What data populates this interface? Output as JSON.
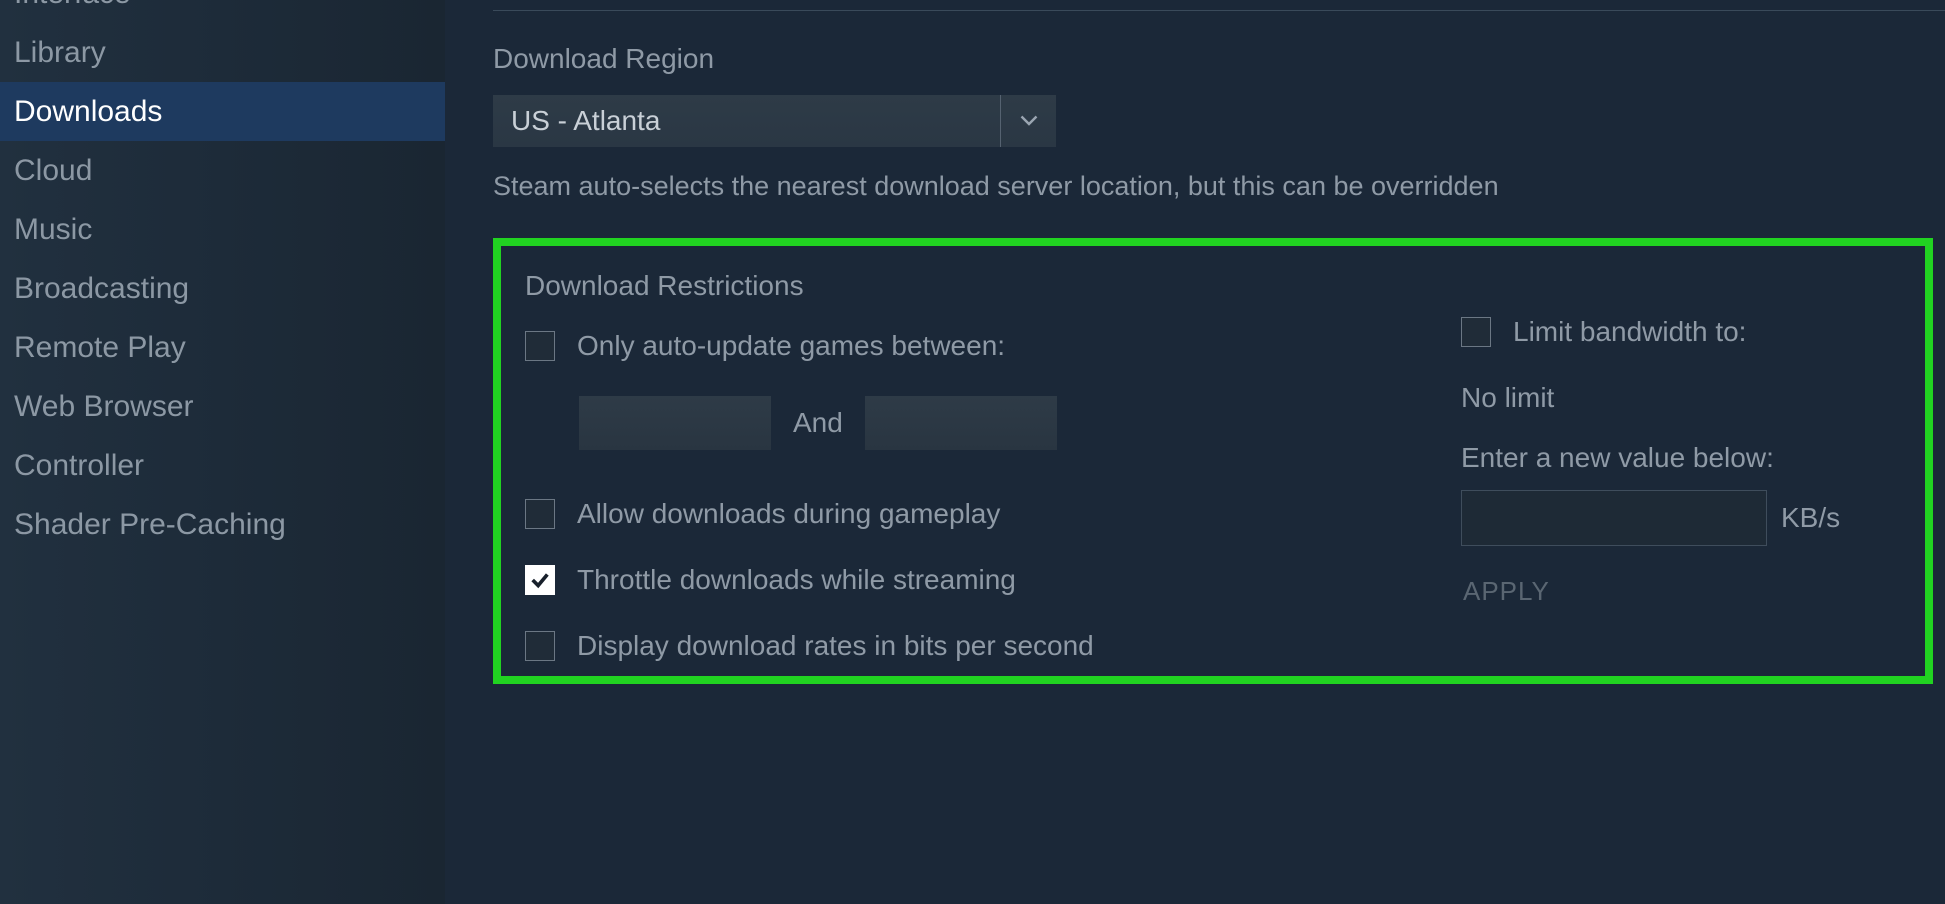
{
  "sidebar": {
    "items": [
      {
        "label": "Interface"
      },
      {
        "label": "Library"
      },
      {
        "label": "Downloads"
      },
      {
        "label": "Cloud"
      },
      {
        "label": "Music"
      },
      {
        "label": "Broadcasting"
      },
      {
        "label": "Remote Play"
      },
      {
        "label": "Web Browser"
      },
      {
        "label": "Controller"
      },
      {
        "label": "Shader Pre-Caching"
      }
    ],
    "selected_index": 2
  },
  "region": {
    "label": "Download Region",
    "value": "US - Atlanta",
    "helper": "Steam auto-selects the nearest download server location, but this can be overridden"
  },
  "restrictions": {
    "title": "Download Restrictions",
    "auto_update": {
      "label": "Only auto-update games between:",
      "checked": false,
      "and_text": "And",
      "from_value": "",
      "to_value": ""
    },
    "allow_during_gameplay": {
      "label": "Allow downloads during gameplay",
      "checked": false
    },
    "throttle_streaming": {
      "label": "Throttle downloads while streaming",
      "checked": true
    },
    "display_bits": {
      "label": "Display download rates in bits per second",
      "checked": false
    },
    "bandwidth": {
      "label": "Limit bandwidth to:",
      "checked": false,
      "status": "No limit",
      "enter_label": "Enter a new value below:",
      "value": "",
      "unit": "KB/s",
      "apply": "APPLY"
    }
  }
}
